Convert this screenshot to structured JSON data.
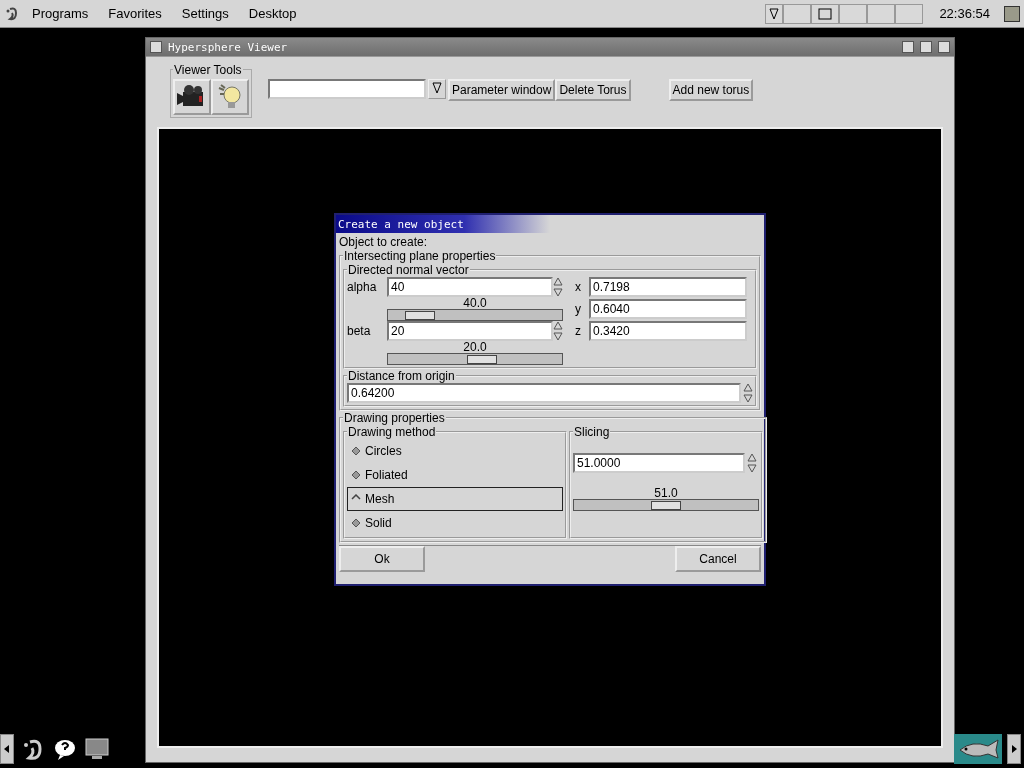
{
  "panel": {
    "menus": [
      "Programs",
      "Favorites",
      "Settings",
      "Desktop"
    ],
    "clock": "22:36:54"
  },
  "main_window": {
    "title": "Hypersphere Viewer",
    "tools_label": "Viewer Tools",
    "buttons": [
      "Parameter window",
      "Delete Torus",
      "Add new torus"
    ]
  },
  "dialog": {
    "title": "Create a new object",
    "object_label": "Object to create:",
    "plane_group": "Intersecting plane properties",
    "normal_group": "Directed normal vector",
    "angles": [
      {
        "label": "alpha",
        "value": "40",
        "reading": "40.0",
        "level": 0.12
      },
      {
        "label": "beta",
        "value": "20",
        "reading": "20.0",
        "level": 0.55
      }
    ],
    "components": [
      {
        "label": "x",
        "value": "0.7198"
      },
      {
        "label": "y",
        "value": "0.6040"
      },
      {
        "label": "z",
        "value": "0.3420"
      }
    ],
    "distance": {
      "label": "Distance from origin",
      "value": "0.64200"
    },
    "drawing_group": "Drawing properties",
    "method": {
      "label": "Drawing method",
      "options": [
        {
          "label": "Circles",
          "selected": false
        },
        {
          "label": "Foliated",
          "selected": false
        },
        {
          "label": "Mesh",
          "selected": true
        },
        {
          "label": "Solid",
          "selected": false
        }
      ]
    },
    "slicing": {
      "label": "Slicing",
      "value": "51.0000",
      "reading": "51.0",
      "level": 0.5
    },
    "buttons": [
      "Ok",
      "Cancel"
    ]
  }
}
